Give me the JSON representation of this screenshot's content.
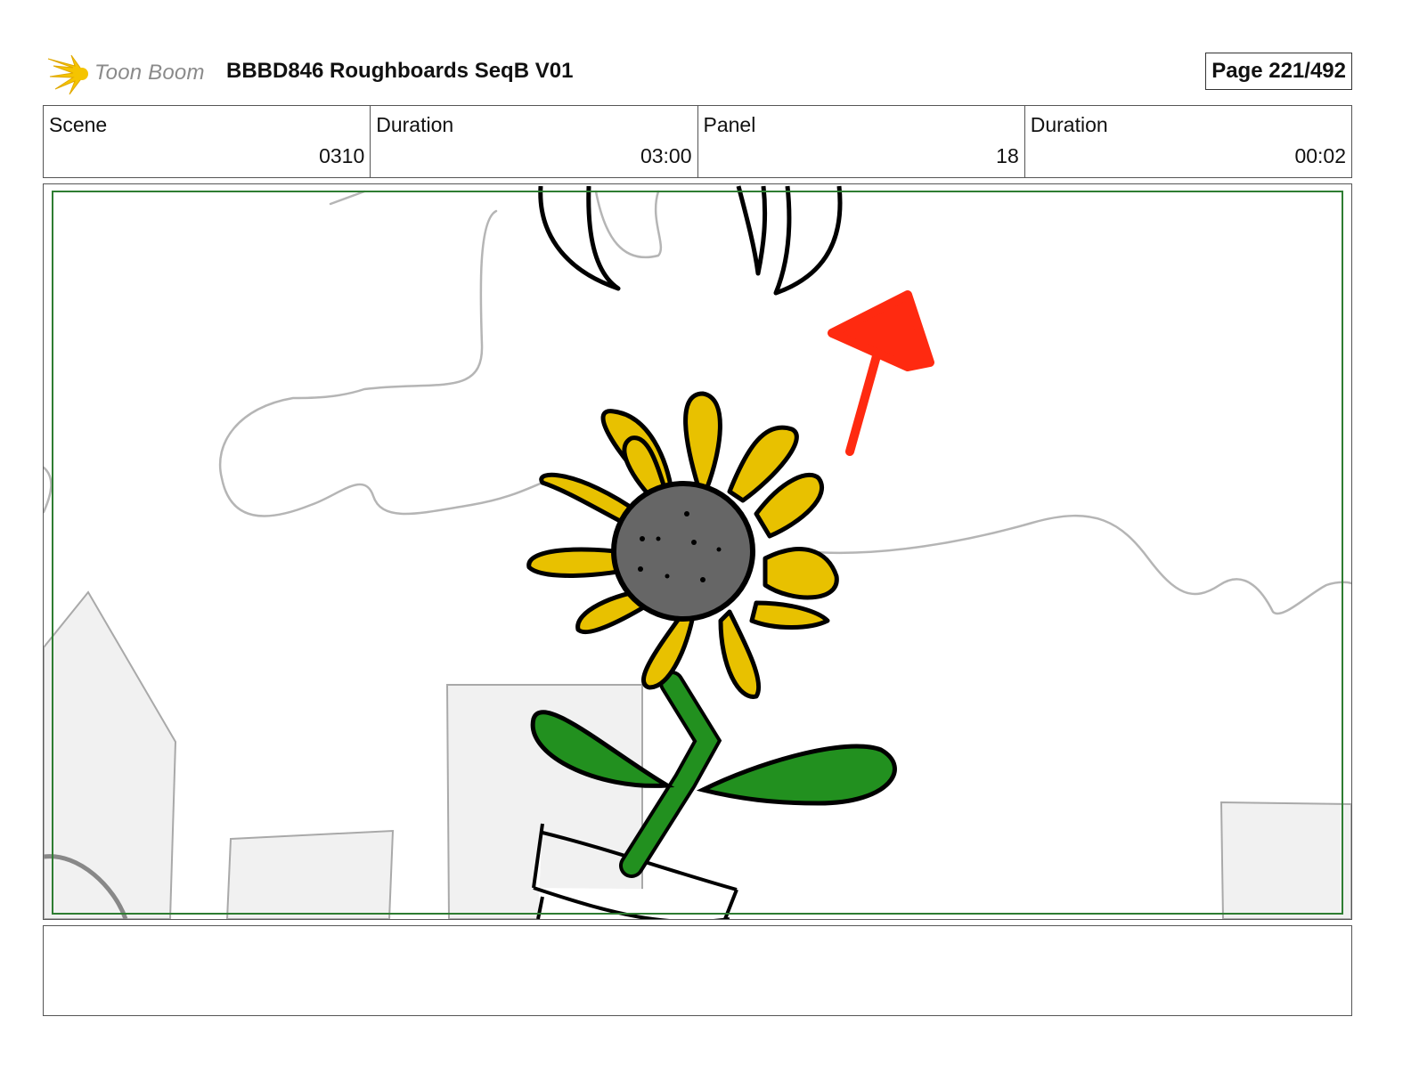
{
  "header": {
    "logo_text": "Toon Boom",
    "title": "BBBD846 Roughboards SeqB V01",
    "page_label": "Page 221/492"
  },
  "info": {
    "scene_label": "Scene",
    "scene_value": "0310",
    "scene_duration_label": "Duration",
    "scene_duration_value": "03:00",
    "panel_label": "Panel",
    "panel_value": "18",
    "panel_duration_label": "Duration",
    "panel_duration_value": "00:02"
  },
  "panel": {
    "illustration": "sunflower-sketch-icon",
    "annotation": "red-arrow-icon",
    "colors": {
      "safe_frame": "#2e7d32",
      "petals": "#e8c100",
      "center": "#666666",
      "leaves": "#22901f",
      "arrow": "#ff2a10",
      "background_sketch": "#b5b5b5"
    }
  },
  "notes": {
    "text": ""
  }
}
